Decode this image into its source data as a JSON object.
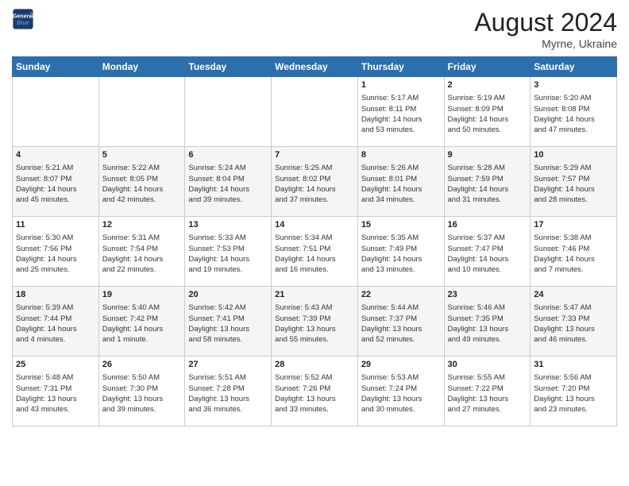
{
  "header": {
    "logo_line1": "General",
    "logo_line2": "Blue",
    "month": "August 2024",
    "location": "Myrne, Ukraine"
  },
  "weekdays": [
    "Sunday",
    "Monday",
    "Tuesday",
    "Wednesday",
    "Thursday",
    "Friday",
    "Saturday"
  ],
  "weeks": [
    [
      {
        "day": "",
        "content": ""
      },
      {
        "day": "",
        "content": ""
      },
      {
        "day": "",
        "content": ""
      },
      {
        "day": "",
        "content": ""
      },
      {
        "day": "1",
        "content": "Sunrise: 5:17 AM\nSunset: 8:11 PM\nDaylight: 14 hours\nand 53 minutes."
      },
      {
        "day": "2",
        "content": "Sunrise: 5:19 AM\nSunset: 8:09 PM\nDaylight: 14 hours\nand 50 minutes."
      },
      {
        "day": "3",
        "content": "Sunrise: 5:20 AM\nSunset: 8:08 PM\nDaylight: 14 hours\nand 47 minutes."
      }
    ],
    [
      {
        "day": "4",
        "content": "Sunrise: 5:21 AM\nSunset: 8:07 PM\nDaylight: 14 hours\nand 45 minutes."
      },
      {
        "day": "5",
        "content": "Sunrise: 5:22 AM\nSunset: 8:05 PM\nDaylight: 14 hours\nand 42 minutes."
      },
      {
        "day": "6",
        "content": "Sunrise: 5:24 AM\nSunset: 8:04 PM\nDaylight: 14 hours\nand 39 minutes."
      },
      {
        "day": "7",
        "content": "Sunrise: 5:25 AM\nSunset: 8:02 PM\nDaylight: 14 hours\nand 37 minutes."
      },
      {
        "day": "8",
        "content": "Sunrise: 5:26 AM\nSunset: 8:01 PM\nDaylight: 14 hours\nand 34 minutes."
      },
      {
        "day": "9",
        "content": "Sunrise: 5:28 AM\nSunset: 7:59 PM\nDaylight: 14 hours\nand 31 minutes."
      },
      {
        "day": "10",
        "content": "Sunrise: 5:29 AM\nSunset: 7:57 PM\nDaylight: 14 hours\nand 28 minutes."
      }
    ],
    [
      {
        "day": "11",
        "content": "Sunrise: 5:30 AM\nSunset: 7:56 PM\nDaylight: 14 hours\nand 25 minutes."
      },
      {
        "day": "12",
        "content": "Sunrise: 5:31 AM\nSunset: 7:54 PM\nDaylight: 14 hours\nand 22 minutes."
      },
      {
        "day": "13",
        "content": "Sunrise: 5:33 AM\nSunset: 7:53 PM\nDaylight: 14 hours\nand 19 minutes."
      },
      {
        "day": "14",
        "content": "Sunrise: 5:34 AM\nSunset: 7:51 PM\nDaylight: 14 hours\nand 16 minutes."
      },
      {
        "day": "15",
        "content": "Sunrise: 5:35 AM\nSunset: 7:49 PM\nDaylight: 14 hours\nand 13 minutes."
      },
      {
        "day": "16",
        "content": "Sunrise: 5:37 AM\nSunset: 7:47 PM\nDaylight: 14 hours\nand 10 minutes."
      },
      {
        "day": "17",
        "content": "Sunrise: 5:38 AM\nSunset: 7:46 PM\nDaylight: 14 hours\nand 7 minutes."
      }
    ],
    [
      {
        "day": "18",
        "content": "Sunrise: 5:39 AM\nSunset: 7:44 PM\nDaylight: 14 hours\nand 4 minutes."
      },
      {
        "day": "19",
        "content": "Sunrise: 5:40 AM\nSunset: 7:42 PM\nDaylight: 14 hours\nand 1 minute."
      },
      {
        "day": "20",
        "content": "Sunrise: 5:42 AM\nSunset: 7:41 PM\nDaylight: 13 hours\nand 58 minutes."
      },
      {
        "day": "21",
        "content": "Sunrise: 5:43 AM\nSunset: 7:39 PM\nDaylight: 13 hours\nand 55 minutes."
      },
      {
        "day": "22",
        "content": "Sunrise: 5:44 AM\nSunset: 7:37 PM\nDaylight: 13 hours\nand 52 minutes."
      },
      {
        "day": "23",
        "content": "Sunrise: 5:46 AM\nSunset: 7:35 PM\nDaylight: 13 hours\nand 49 minutes."
      },
      {
        "day": "24",
        "content": "Sunrise: 5:47 AM\nSunset: 7:33 PM\nDaylight: 13 hours\nand 46 minutes."
      }
    ],
    [
      {
        "day": "25",
        "content": "Sunrise: 5:48 AM\nSunset: 7:31 PM\nDaylight: 13 hours\nand 43 minutes."
      },
      {
        "day": "26",
        "content": "Sunrise: 5:50 AM\nSunset: 7:30 PM\nDaylight: 13 hours\nand 39 minutes."
      },
      {
        "day": "27",
        "content": "Sunrise: 5:51 AM\nSunset: 7:28 PM\nDaylight: 13 hours\nand 36 minutes."
      },
      {
        "day": "28",
        "content": "Sunrise: 5:52 AM\nSunset: 7:26 PM\nDaylight: 13 hours\nand 33 minutes."
      },
      {
        "day": "29",
        "content": "Sunrise: 5:53 AM\nSunset: 7:24 PM\nDaylight: 13 hours\nand 30 minutes."
      },
      {
        "day": "30",
        "content": "Sunrise: 5:55 AM\nSunset: 7:22 PM\nDaylight: 13 hours\nand 27 minutes."
      },
      {
        "day": "31",
        "content": "Sunrise: 5:56 AM\nSunset: 7:20 PM\nDaylight: 13 hours\nand 23 minutes."
      }
    ]
  ]
}
